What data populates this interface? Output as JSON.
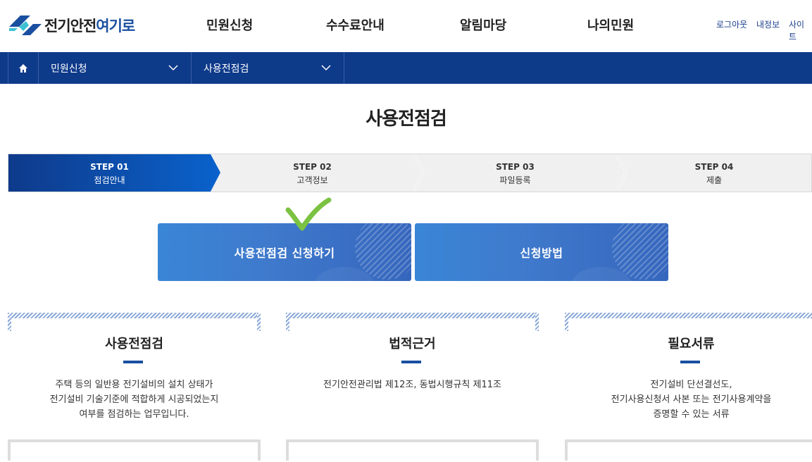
{
  "logo": {
    "text_a": "전기안전",
    "text_b": "여기로"
  },
  "gnb": [
    "민원신청",
    "수수료안내",
    "알림마당",
    "나의민원"
  ],
  "util": [
    "로그아웃",
    "내정보",
    "사이트"
  ],
  "subnav": {
    "menu1": "민원신청",
    "menu2": "사용전점검"
  },
  "page_title": "사용전점검",
  "steps": [
    {
      "num": "STEP 01",
      "name": "점검안내",
      "active": true
    },
    {
      "num": "STEP 02",
      "name": "고객정보",
      "active": false
    },
    {
      "num": "STEP 03",
      "name": "파일등록",
      "active": false
    },
    {
      "num": "STEP 04",
      "name": "제출",
      "active": false
    }
  ],
  "actions": {
    "apply": "사용전점검 신청하기",
    "method": "신청방법"
  },
  "cards": [
    {
      "title": "사용전점검",
      "desc": [
        "주택 등의 일반용 전기설비의 설치 상태가",
        "전기설비 기술기준에 적합하게 시공되었는지",
        "여부를 점검하는 업무입니다."
      ]
    },
    {
      "title": "법적근거",
      "desc": [
        "전기안전관리법 제12조, 동법시행규칙 제11조"
      ]
    },
    {
      "title": "필요서류",
      "desc": [
        "전기설비 단선결선도,",
        "전기사용신청서 사본 또는 전기사용계약을",
        "증명할 수 있는 서류"
      ]
    }
  ],
  "colors": {
    "primary": "#0e3a8a",
    "step_active": "#0a59c4",
    "check": "#7cc242"
  }
}
